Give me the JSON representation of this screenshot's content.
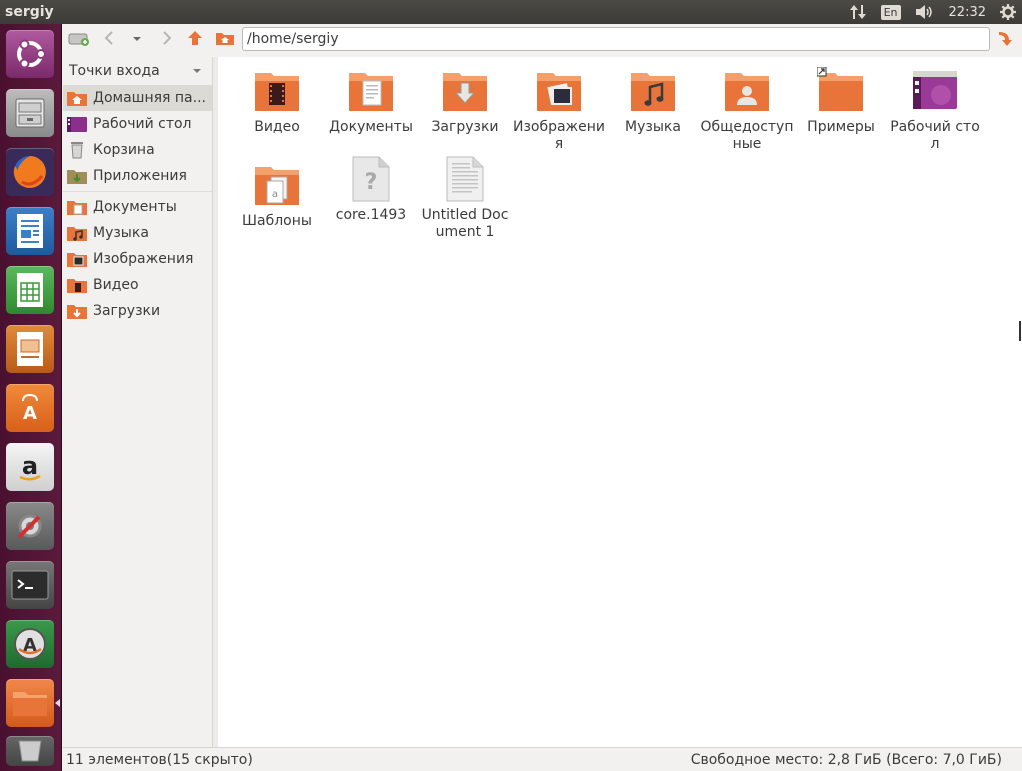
{
  "panel": {
    "title": "sergiy",
    "lang": "En",
    "time": "22:32"
  },
  "launcher": {
    "items": [
      {
        "name": "ubuntu-dash",
        "icon": "ubuntu-logo-icon"
      },
      {
        "name": "file-cabinet",
        "icon": "file-cabinet-icon"
      },
      {
        "name": "firefox",
        "icon": "firefox-icon"
      },
      {
        "name": "libreoffice-writer",
        "icon": "writer-icon"
      },
      {
        "name": "libreoffice-calc",
        "icon": "calc-icon"
      },
      {
        "name": "libreoffice-impress",
        "icon": "impress-icon"
      },
      {
        "name": "ubuntu-software",
        "icon": "software-center-icon"
      },
      {
        "name": "amazon",
        "icon": "amazon-icon"
      },
      {
        "name": "system-settings",
        "icon": "settings-icon"
      },
      {
        "name": "terminal",
        "icon": "terminal-icon"
      },
      {
        "name": "software-updater",
        "icon": "updater-icon"
      },
      {
        "name": "files",
        "icon": "folder-icon"
      },
      {
        "name": "trash",
        "icon": "trash-icon"
      }
    ]
  },
  "toolbar": {
    "path": "/home/sergiy"
  },
  "sidebar": {
    "header": "Точки входа",
    "places": [
      {
        "label": "Домашняя па...",
        "icon": "home-folder-icon",
        "selected": true
      },
      {
        "label": "Рабочий стол",
        "icon": "desktop-icon"
      },
      {
        "label": "Корзина",
        "icon": "trash-icon"
      },
      {
        "label": "Приложения",
        "icon": "applications-icon"
      }
    ],
    "bookmarks": [
      {
        "label": "Документы",
        "icon": "documents-folder-icon"
      },
      {
        "label": "Музыка",
        "icon": "music-folder-icon"
      },
      {
        "label": "Изображения",
        "icon": "pictures-folder-icon"
      },
      {
        "label": "Видео",
        "icon": "videos-folder-icon"
      },
      {
        "label": "Загрузки",
        "icon": "downloads-folder-icon"
      }
    ]
  },
  "files": [
    {
      "label": "Видео",
      "icon": "videos-folder-icon"
    },
    {
      "label": "Документы",
      "icon": "documents-folder-icon"
    },
    {
      "label": "Загрузки",
      "icon": "downloads-folder-icon"
    },
    {
      "label": "Изображения",
      "icon": "pictures-folder-icon"
    },
    {
      "label": "Музыка",
      "icon": "music-folder-icon"
    },
    {
      "label": "Общедоступные",
      "icon": "public-folder-icon"
    },
    {
      "label": "Примеры",
      "icon": "examples-folder-icon"
    },
    {
      "label": "Рабочий стол",
      "icon": "desktop-folder-icon"
    },
    {
      "label": "Шаблоны",
      "icon": "templates-folder-icon"
    },
    {
      "label": "core.1493",
      "icon": "unknown-file-icon"
    },
    {
      "label": "Untitled Document 1",
      "icon": "text-document-icon"
    }
  ],
  "status": {
    "left": "11 элементов(15 скрыто)",
    "right": "Свободное место: 2,8 ГиБ (Всего: 7,0 ГиБ)"
  },
  "colors": {
    "folder": "#e9743a",
    "launcher": "#5a1a3c",
    "selected": "#dcdad5"
  }
}
